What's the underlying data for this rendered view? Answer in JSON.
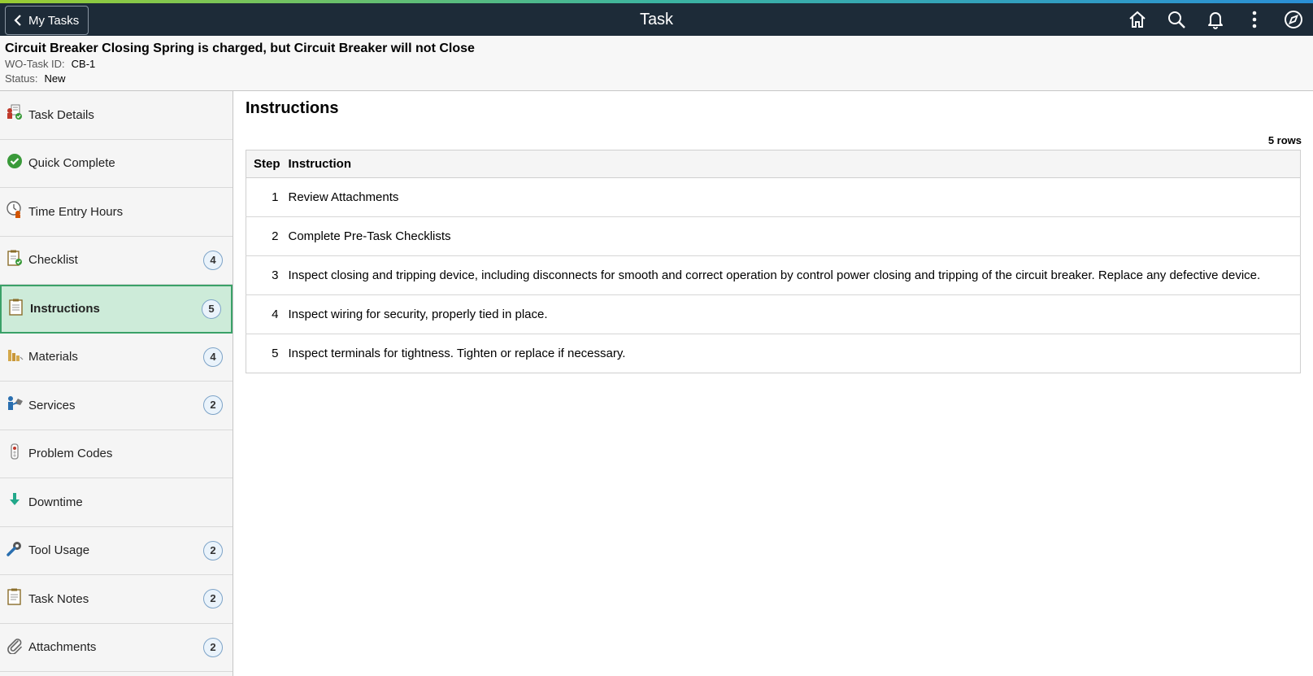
{
  "header": {
    "back_label": "My Tasks",
    "title": "Task",
    "icons": [
      "home-icon",
      "search-icon",
      "bell-icon",
      "more-icon",
      "compass-icon"
    ]
  },
  "task": {
    "title": "Circuit Breaker Closing Spring is charged, but Circuit Breaker will not Close",
    "id_label": "WO-Task ID:",
    "id_value": "CB-1",
    "status_label": "Status:",
    "status_value": "New"
  },
  "sidebar": {
    "items": [
      {
        "label": "Task Details",
        "icon": "task-details-icon",
        "badge": ""
      },
      {
        "label": "Quick Complete",
        "icon": "check-circle-icon",
        "badge": ""
      },
      {
        "label": "Time Entry Hours",
        "icon": "clock-icon",
        "badge": ""
      },
      {
        "label": "Checklist",
        "icon": "checklist-icon",
        "badge": "4"
      },
      {
        "label": "Instructions",
        "icon": "clipboard-icon",
        "badge": "5",
        "active": true
      },
      {
        "label": "Materials",
        "icon": "materials-icon",
        "badge": "4"
      },
      {
        "label": "Services",
        "icon": "services-icon",
        "badge": "2"
      },
      {
        "label": "Problem Codes",
        "icon": "problem-codes-icon",
        "badge": ""
      },
      {
        "label": "Downtime",
        "icon": "down-arrow-icon",
        "badge": ""
      },
      {
        "label": "Tool Usage",
        "icon": "wrench-icon",
        "badge": "2"
      },
      {
        "label": "Task Notes",
        "icon": "notes-icon",
        "badge": "2"
      },
      {
        "label": "Attachments",
        "icon": "paperclip-icon",
        "badge": "2"
      }
    ]
  },
  "main": {
    "title": "Instructions",
    "row_count": "5 rows",
    "columns": [
      "Step",
      "Instruction"
    ],
    "rows": [
      {
        "step": "1",
        "instruction": "Review Attachments"
      },
      {
        "step": "2",
        "instruction": "Complete Pre-Task Checklists"
      },
      {
        "step": "3",
        "instruction": "Inspect closing and tripping device, including disconnects for smooth and correct operation by control power closing and tripping of the circuit breaker.  Replace any defective device."
      },
      {
        "step": "4",
        "instruction": "Inspect wiring for security, properly tied in place."
      },
      {
        "step": "5",
        "instruction": "Inspect terminals for tightness.  Tighten or replace if necessary."
      }
    ]
  }
}
